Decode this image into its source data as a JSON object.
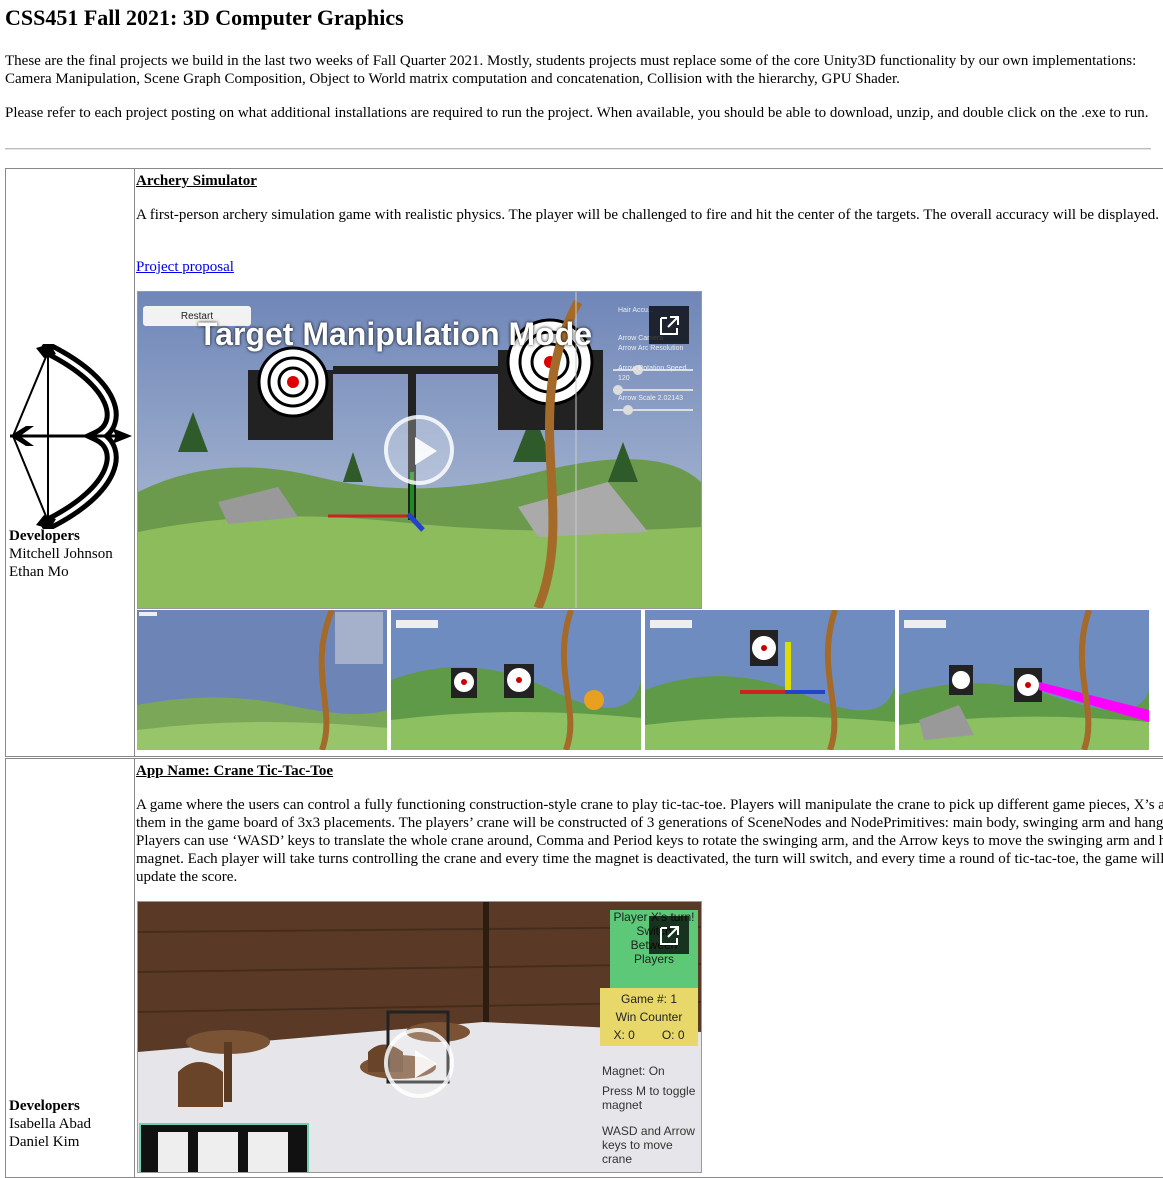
{
  "page": {
    "title": "CSS451 Fall 2021: 3D Computer Graphics",
    "intro1": "These are the final projects we build in the last two weeks of Fall Quarter 2021. Mostly, students projects must replace some of the core Unity3D functionality by our own implementations: Camera Manipulation, Scene Graph Composition, Object to World matrix computation and concatenation, Collision with the hierarchy, GPU Shader.",
    "intro2": "Please refer to each project posting on what additional installations are required to run the project. When available, you should be able to download, unzip, and double click on the .exe to run."
  },
  "projects": [
    {
      "developers_label": "Developers",
      "developers": [
        "Mitchell Johnson",
        "Ethan Mo"
      ],
      "title": "Archery Simulator",
      "description": "A first-person archery simulation game with realistic physics. The player will be challenged to fire and hit the center of the targets. The overall accuracy will be displayed.",
      "link": "Project proposal",
      "video": {
        "overlay_title": "Target Manipulation Mode",
        "restart": "Restart",
        "hud": [
          "Hair Accu...",
          "Arrow Camera",
          "Arrow Arc Resolution",
          "Arrow Rotation Speed 120",
          "Arrow Scale 2.02143"
        ]
      },
      "thumbnails": [
        "thumb-1",
        "thumb-2",
        "thumb-3",
        "thumb-4"
      ],
      "logo_icon": "bow-and-arrow-icon"
    },
    {
      "developers_label": "Developers",
      "developers": [
        "Isabella Abad",
        "Daniel Kim"
      ],
      "title": "App Name: Crane Tic-Tac-Toe",
      "description": "A game where the users can control a fully functioning construction-style crane to play tic-tac-toe. Players will manipulate the crane to pick up different game pieces, X’s and place them in the game board of 3x3 placements. The players’ crane will be constructed of 3 generations of SceneNodes and NodePrimitives: main body, swinging arm and hanging magnet. Players can use ‘WASD’ keys to translate the whole crane around, Comma and Period keys to rotate the swinging arm, and the Arrow keys to move the swinging arm and hanging magnet. Each player will take turns controlling the crane and every time the magnet is deactivated, the turn will switch, and every time a round of tic-tac-toe, the game will reset and update the score.",
      "video": {
        "turn_panel": [
          "Player X's turn!",
          "Switch",
          "Between",
          "Players"
        ],
        "game_number": "Game #: 1",
        "win_counter": "Win Counter",
        "score_x": "X: 0",
        "score_o": "O: 0",
        "magnet": "Magnet: On",
        "toggle_hint": "Press M to toggle magnet",
        "move_hint": "WASD and Arrow keys to move crane"
      }
    }
  ]
}
